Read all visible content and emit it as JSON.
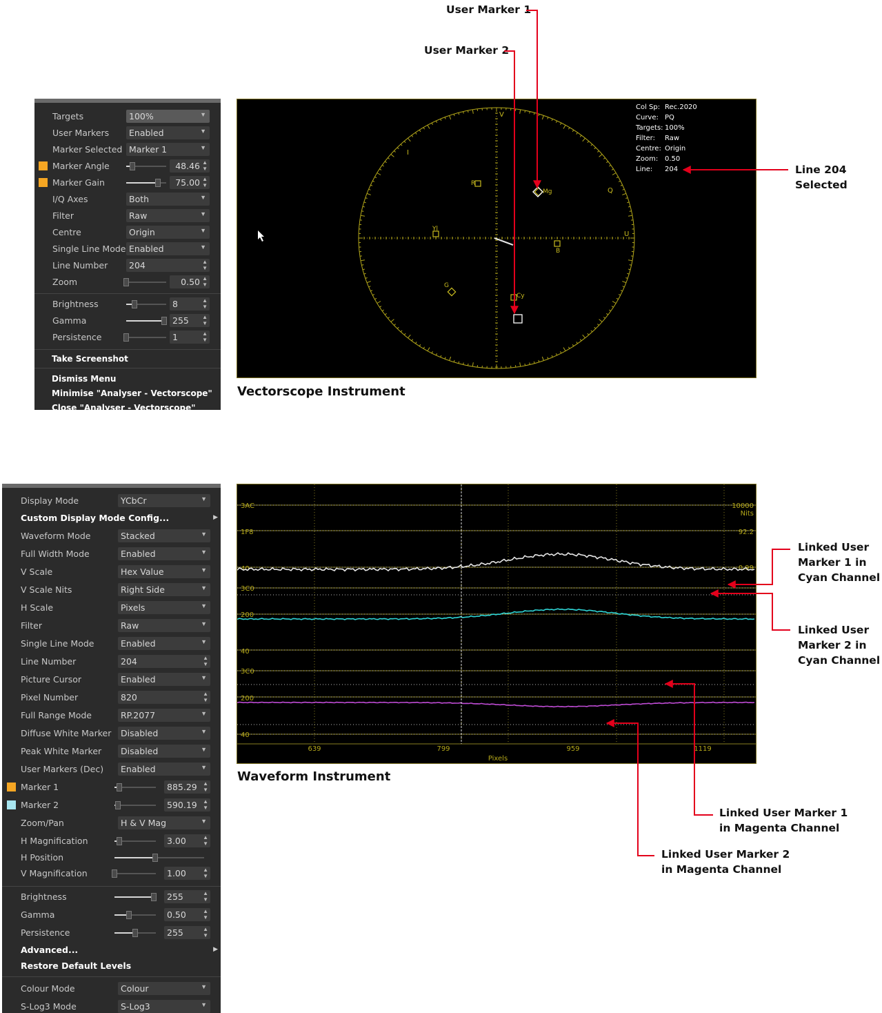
{
  "vectorscope_menu": {
    "rows": [
      {
        "label": "Targets",
        "value": "100%"
      },
      {
        "label": "User Markers",
        "value": "Enabled"
      },
      {
        "label": "Marker Selected",
        "value": "Marker 1"
      },
      {
        "label": "Marker Angle",
        "value": "48.46"
      },
      {
        "label": "Marker Gain",
        "value": "75.00"
      },
      {
        "label": "I/Q Axes",
        "value": "Both"
      },
      {
        "label": "Filter",
        "value": "Raw"
      },
      {
        "label": "Centre",
        "value": "Origin"
      },
      {
        "label": "Single Line Mode",
        "value": "Enabled"
      },
      {
        "label": "Line Number",
        "value": "204"
      },
      {
        "label": "Zoom",
        "value": "0.50"
      },
      {
        "label": "Brightness",
        "value": "8"
      },
      {
        "label": "Gamma",
        "value": "255"
      },
      {
        "label": "Persistence",
        "value": "1"
      }
    ],
    "actions": [
      "Take Screenshot",
      "Dismiss Menu",
      "Minimise \"Analyser - Vectorscope\"",
      "Close \"Analyser - Vectorscope\""
    ],
    "marker_color": "#f5a623"
  },
  "vectorscope": {
    "info_keys": [
      "Col Sp:",
      "Curve:",
      "Targets:",
      "Filter:",
      "Centre:",
      "Zoom:",
      "Line:"
    ],
    "info_values": [
      "Rec.2020",
      "PQ",
      "100%",
      "Raw",
      "Origin",
      "0.50",
      "204"
    ],
    "axis_labels": {
      "v": "V",
      "u": "U",
      "i": "I",
      "q": "Q"
    },
    "targets": {
      "r": "R",
      "mg": "Mg",
      "b": "B",
      "yl": "Yl",
      "g": "G",
      "cy": "Cy"
    },
    "caption": "Vectorscope Instrument",
    "graticule_color": "#b5a81a"
  },
  "callouts": {
    "user_marker_1": "User Marker 1",
    "user_marker_2": "User Marker 2",
    "line_204": [
      "Line 204",
      "Selected"
    ],
    "linked_1_cyan": [
      "Linked User",
      "Marker 1 in",
      "Cyan Channel"
    ],
    "linked_2_cyan": [
      "Linked User",
      "Marker 2 in",
      "Cyan Channel"
    ],
    "linked_1_magenta": [
      "Linked User Marker 1",
      "in Magenta Channel"
    ],
    "linked_2_magenta": [
      "Linked User Marker 2",
      "in Magenta Channel"
    ],
    "arrow_color": "#e3001b"
  },
  "waveform_menu": {
    "rows": [
      {
        "label": "Display Mode",
        "value": "YCbCr"
      },
      {
        "label": "Custom Display Mode Config...",
        "value": ""
      },
      {
        "label": "Waveform Mode",
        "value": "Stacked"
      },
      {
        "label": "Full Width Mode",
        "value": "Enabled"
      },
      {
        "label": "V Scale",
        "value": "Hex Value"
      },
      {
        "label": "V Scale Nits",
        "value": "Right Side"
      },
      {
        "label": "H Scale",
        "value": "Pixels"
      },
      {
        "label": "Filter",
        "value": "Raw"
      },
      {
        "label": "Single Line Mode",
        "value": "Enabled"
      },
      {
        "label": "Line Number",
        "value": "204"
      },
      {
        "label": "Picture Cursor",
        "value": "Enabled"
      },
      {
        "label": "Pixel Number",
        "value": "820"
      },
      {
        "label": "Full Range Mode",
        "value": "RP.2077"
      },
      {
        "label": "Diffuse White Marker",
        "value": "Disabled"
      },
      {
        "label": "Peak White Marker",
        "value": "Disabled"
      },
      {
        "label": "User Markers (Dec)",
        "value": "Enabled"
      },
      {
        "label": "Marker 1",
        "value": "885.29"
      },
      {
        "label": "Marker 2",
        "value": "590.19"
      },
      {
        "label": "Zoom/Pan",
        "value": "H & V Mag"
      },
      {
        "label": "H Magnification",
        "value": "3.00"
      },
      {
        "label": "H Position",
        "value": ""
      },
      {
        "label": "V Magnification",
        "value": "1.00"
      },
      {
        "label": "Brightness",
        "value": "255"
      },
      {
        "label": "Gamma",
        "value": "0.50"
      },
      {
        "label": "Persistence",
        "value": "255"
      },
      {
        "label": "Advanced...",
        "value": ""
      },
      {
        "label": "Restore Default Levels",
        "value": ""
      },
      {
        "label": "Colour Mode",
        "value": "Colour"
      },
      {
        "label": "S-Log3 Mode",
        "value": "S-Log3"
      }
    ],
    "marker1_color": "#f5a623",
    "marker2_color": "#a8e6f0"
  },
  "waveform": {
    "left_labels": [
      "3AC",
      "1F8",
      "40",
      "3C0",
      "200",
      "40",
      "3C0",
      "200",
      "40"
    ],
    "right_labels": [
      "10000",
      "Nits",
      "92.2",
      "0.99"
    ],
    "x_ticks": [
      "639",
      "799",
      "959",
      "1119"
    ],
    "x_label": "Pixels",
    "caption": "Waveform Instrument",
    "trace_colors": {
      "luma": "#e6e6e6",
      "cyan": "#2fd6d6",
      "magenta": "#c04cd6"
    }
  }
}
